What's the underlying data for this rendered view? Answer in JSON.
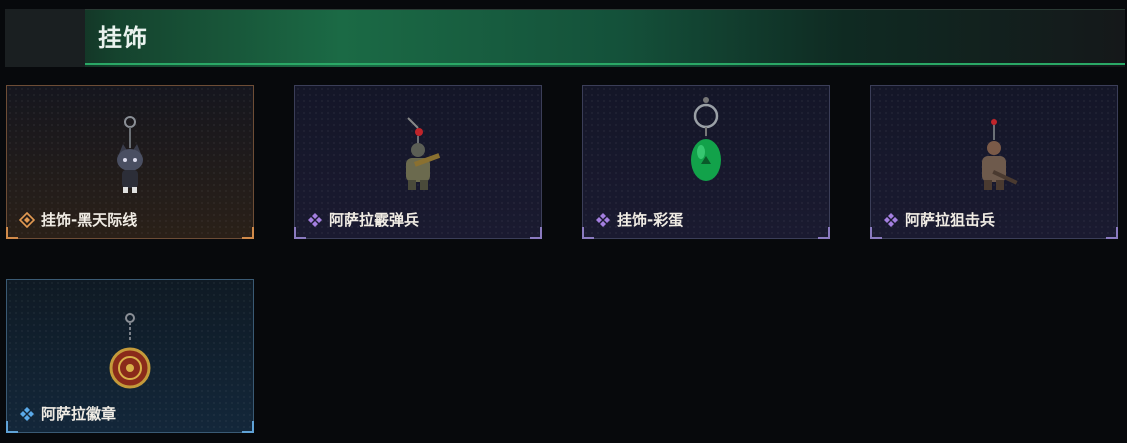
{
  "header": {
    "title": "挂饰"
  },
  "colors": {
    "legend": "#e39a52",
    "epic": "#a47fe0",
    "rare": "#5aa9e8",
    "accent": "#2aa866"
  },
  "items": [
    {
      "label": "挂饰-黑天际线",
      "rarity": "legend",
      "icon": "cat-charm-icon"
    },
    {
      "label": "阿萨拉霰弹兵",
      "rarity": "epic",
      "icon": "soldier-charm-icon"
    },
    {
      "label": "挂饰-彩蛋",
      "rarity": "epic",
      "icon": "green-egg-charm-icon"
    },
    {
      "label": "阿萨拉狙击兵",
      "rarity": "epic",
      "icon": "sniper-charm-icon"
    },
    {
      "label": "阿萨拉徽章",
      "rarity": "rare",
      "icon": "badge-charm-icon"
    }
  ]
}
